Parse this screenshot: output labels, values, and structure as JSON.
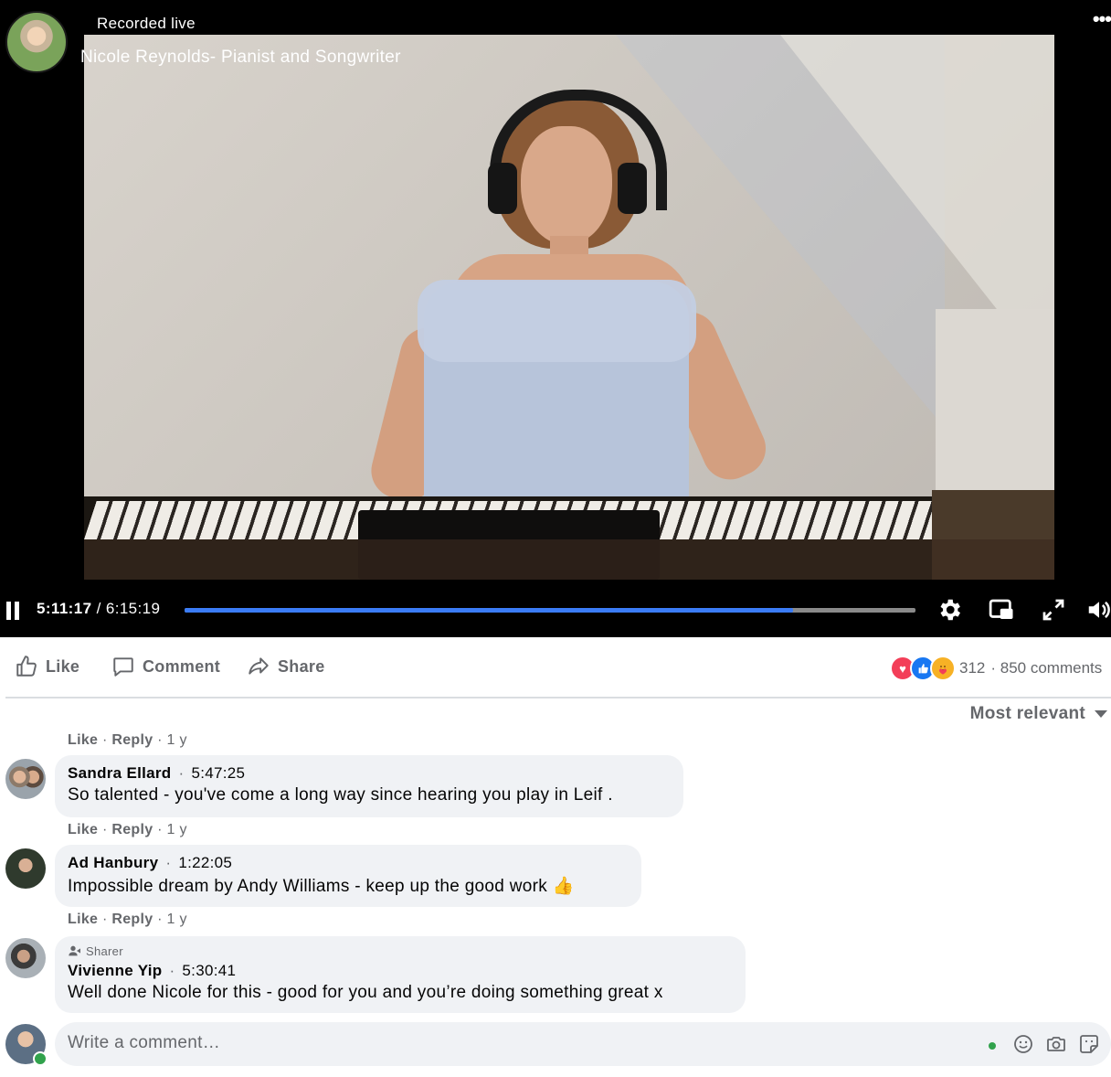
{
  "video": {
    "status_label": "Recorded live",
    "title": "Nicole Reynolds- Pianist and Songwriter",
    "more_label": "•••",
    "current_time": "5:11:17",
    "separator": " / ",
    "duration": "6:15:19",
    "progress_fraction": 0.833
  },
  "actions": {
    "like_label": "Like",
    "comment_label": "Comment",
    "share_label": "Share",
    "reaction_count": "312",
    "comments_count": "· 850 comments"
  },
  "sort": {
    "label": "Most relevant"
  },
  "comments": [
    {
      "meta": {
        "like": "Like",
        "sep1": " · ",
        "reply": "Reply",
        "age": " · 1 y"
      }
    },
    {
      "name": "Sandra Ellard",
      "dot": "·",
      "time": "5:47:25",
      "text": "So talented - you've come a long way since hearing you play in Leif .",
      "meta": {
        "like": "Like",
        "sep1": " · ",
        "reply": "Reply",
        "age": " · 1 y"
      }
    },
    {
      "name": "Ad Hanbury",
      "dot": "·",
      "time": "1:22:05",
      "text": "Impossible dream by Andy Williams - keep up the good work 👍",
      "meta": {
        "like": "Like",
        "sep1": " · ",
        "reply": "Reply",
        "age": " · 1 y"
      }
    },
    {
      "badge": "Sharer",
      "name": "Vivienne Yip",
      "dot": "·",
      "time": "5:30:41",
      "text": "Well done Nicole for this - good for you and you’re doing something great x"
    }
  ],
  "composer": {
    "placeholder": "Write a comment…"
  },
  "colors": {
    "accent": "#3b7cf6",
    "love": "#f33e58",
    "like": "#1877f2",
    "online": "#31a24c"
  }
}
